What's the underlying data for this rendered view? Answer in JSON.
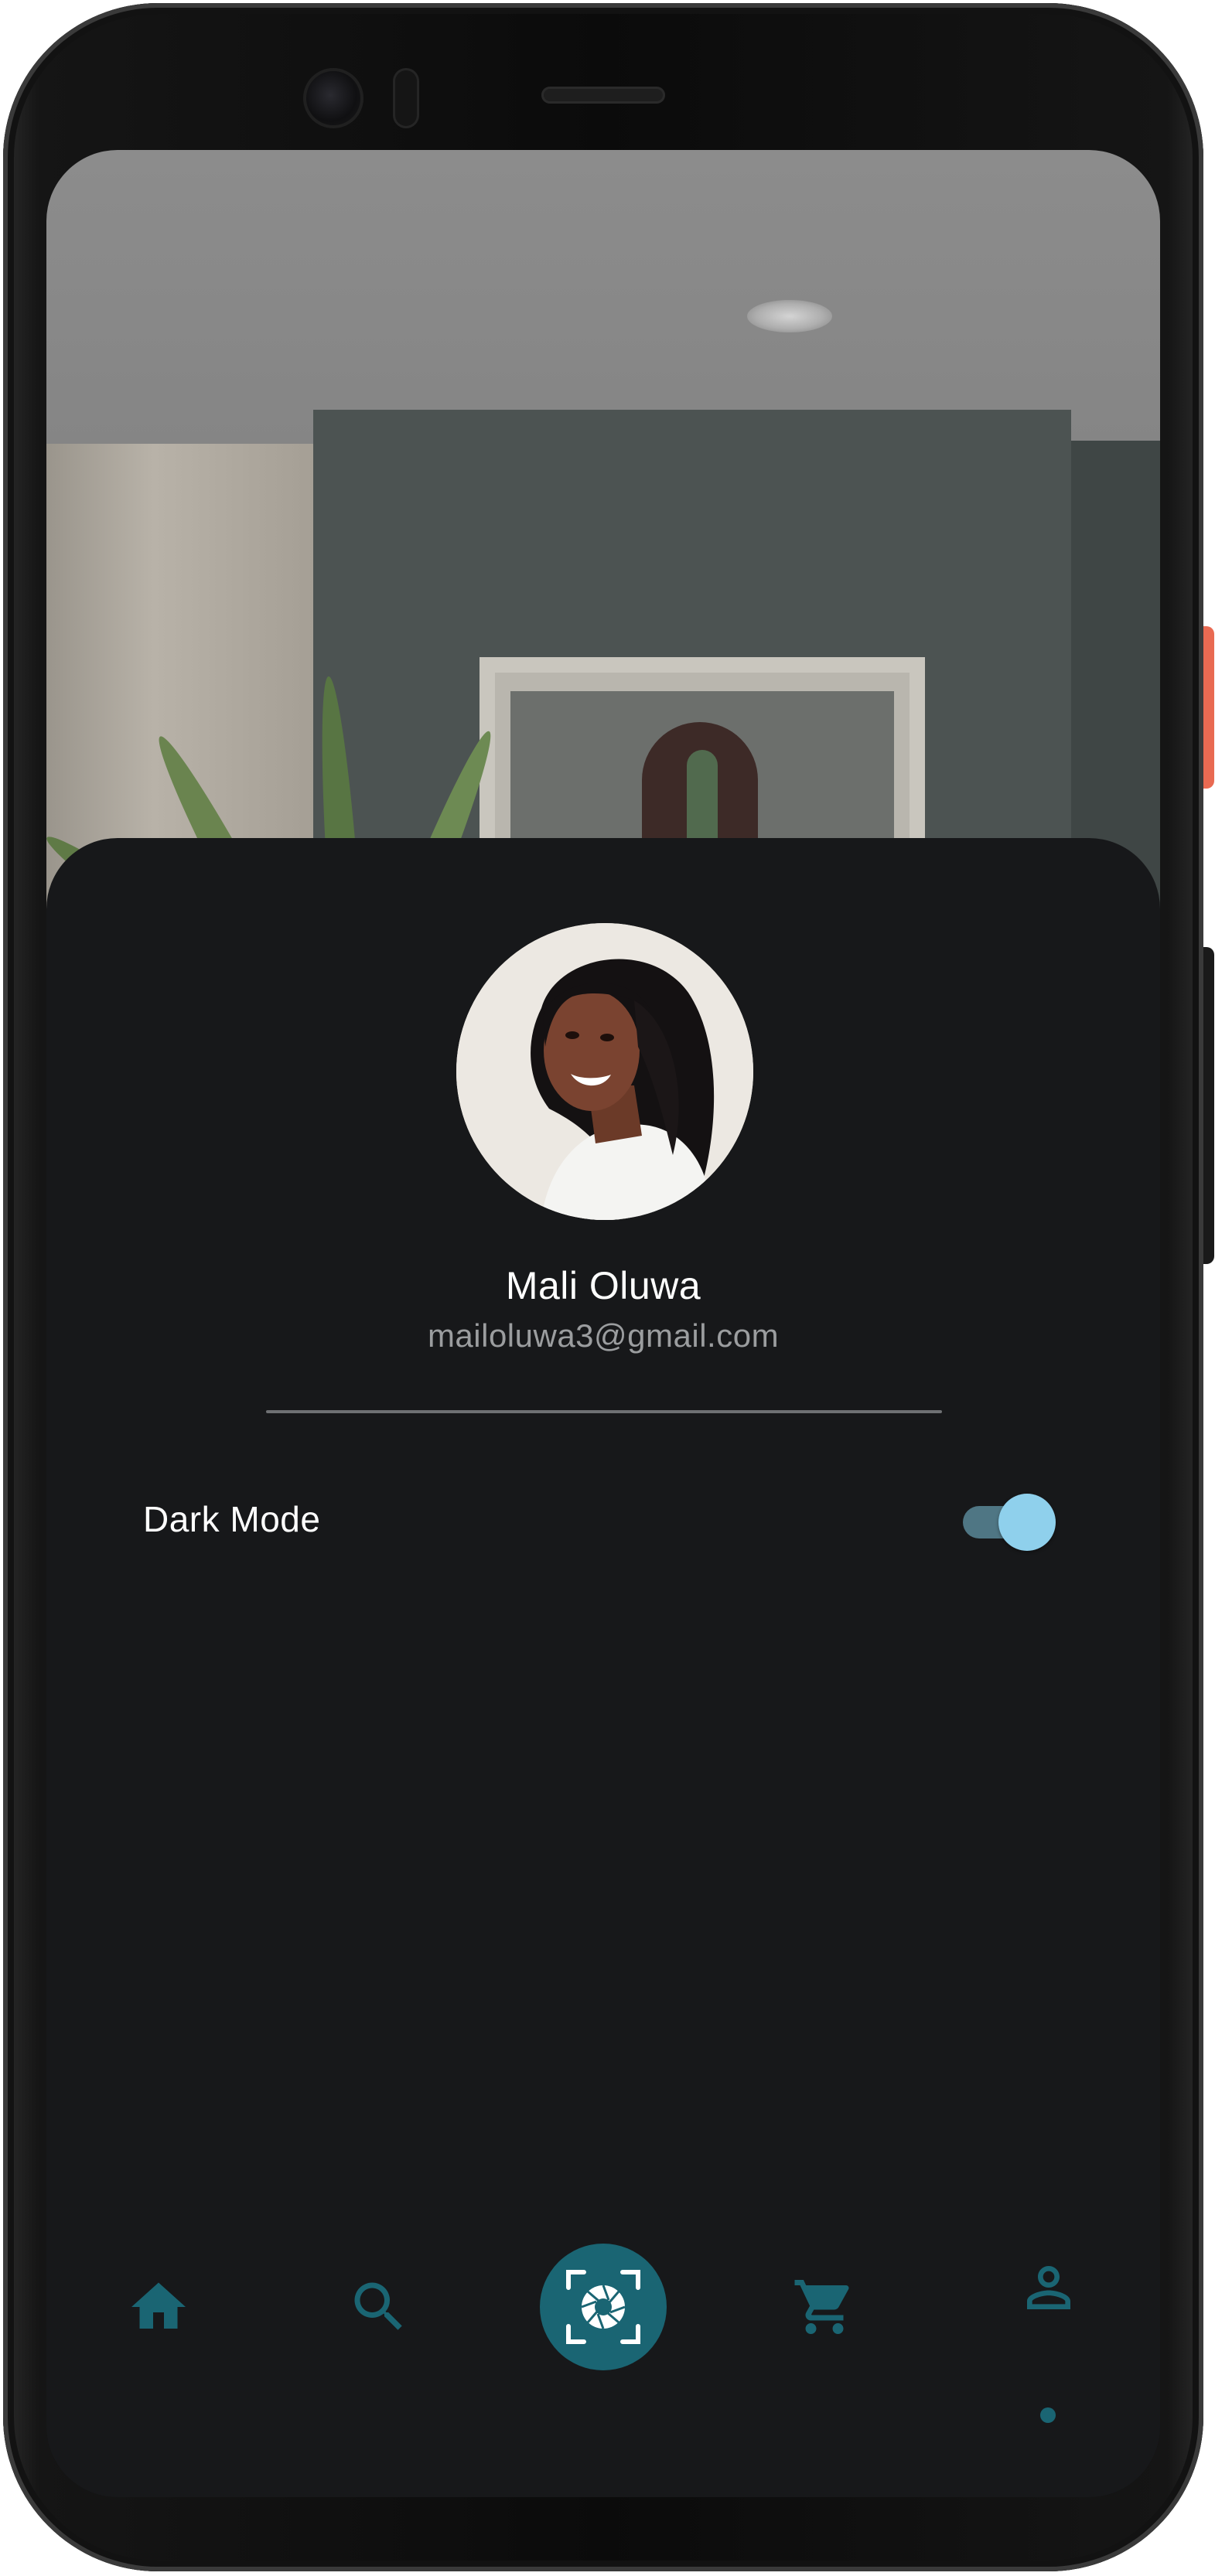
{
  "profile": {
    "name": "Mali Oluwa",
    "email": "mailoluwa3@gmail.com"
  },
  "settings": {
    "dark_mode_label": "Dark Mode",
    "dark_mode_enabled": true
  },
  "bottom_nav": {
    "items": [
      {
        "icon": "home-icon"
      },
      {
        "icon": "search-icon"
      },
      {
        "icon": "camera-shutter-icon"
      },
      {
        "icon": "cart-icon"
      },
      {
        "icon": "profile-icon"
      }
    ],
    "active_index": 4
  },
  "colors": {
    "accent": "#1a6573",
    "sheet_background": "#17181a",
    "toggle_thumb": "#8fd0ec",
    "toggle_track": "#4f7684",
    "power_button": "#e96a52"
  }
}
